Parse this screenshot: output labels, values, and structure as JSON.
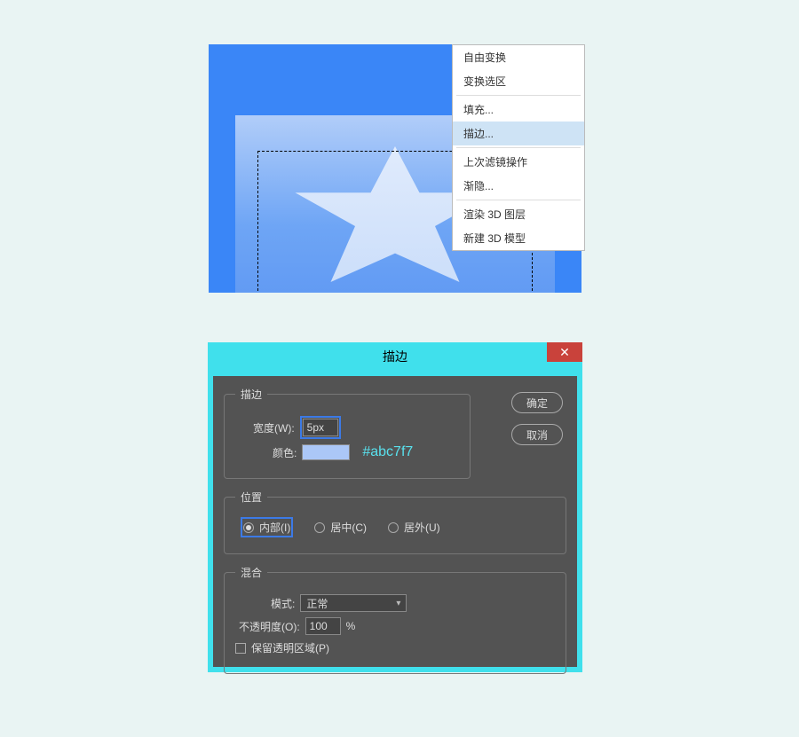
{
  "menu": {
    "items": [
      "自由变换",
      "变换选区",
      "填充...",
      "描边...",
      "上次滤镜操作",
      "渐隐...",
      "渲染 3D 图层",
      "新建 3D 模型"
    ],
    "hovered_index": 3
  },
  "dialog": {
    "title": "描边",
    "sections": {
      "stroke": {
        "legend": "描边",
        "width_label": "宽度(W):",
        "width_value": "5px",
        "color_label": "颜色:",
        "color_hex": "#abc7f7"
      },
      "position": {
        "legend": "位置",
        "options": [
          "内部(I)",
          "居中(C)",
          "居外(U)"
        ],
        "selected_index": 0
      },
      "blend": {
        "legend": "混合",
        "mode_label": "模式:",
        "mode_value": "正常",
        "opacity_label": "不透明度(O):",
        "opacity_value": "100",
        "opacity_suffix": "%",
        "preserve_label": "保留透明区域(P)"
      }
    },
    "buttons": {
      "ok": "确定",
      "cancel": "取消"
    }
  }
}
